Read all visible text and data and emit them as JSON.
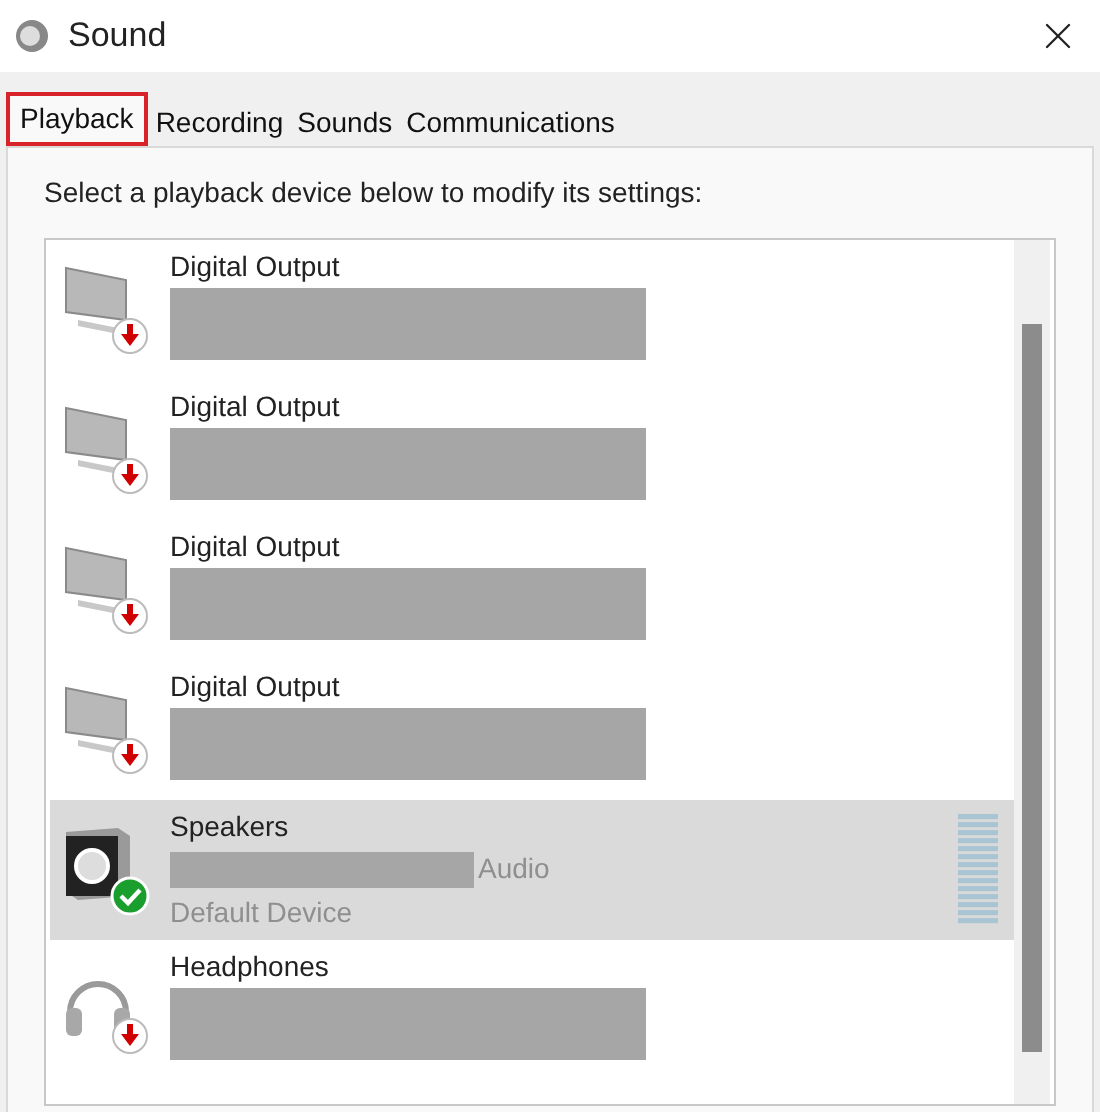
{
  "window": {
    "title": "Sound"
  },
  "tabs": [
    {
      "label": "Playback",
      "selected": true
    },
    {
      "label": "Recording",
      "selected": false
    },
    {
      "label": "Sounds",
      "selected": false
    },
    {
      "label": "Communications",
      "selected": false
    }
  ],
  "instruction": "Select a playback device below to modify its settings:",
  "devices": [
    {
      "name": "Digital Output",
      "kind": "monitor",
      "default": false,
      "selected": false
    },
    {
      "name": "Digital Output",
      "kind": "monitor",
      "default": false,
      "selected": false
    },
    {
      "name": "Digital Output",
      "kind": "monitor",
      "default": false,
      "selected": false
    },
    {
      "name": "Digital Output",
      "kind": "monitor",
      "default": false,
      "selected": false
    },
    {
      "name": "Speakers",
      "kind": "speaker",
      "default": true,
      "selected": true,
      "detail": "Audio",
      "state_text": "Default Device"
    },
    {
      "name": "Headphones",
      "kind": "headphones",
      "default": false,
      "selected": false
    }
  ]
}
